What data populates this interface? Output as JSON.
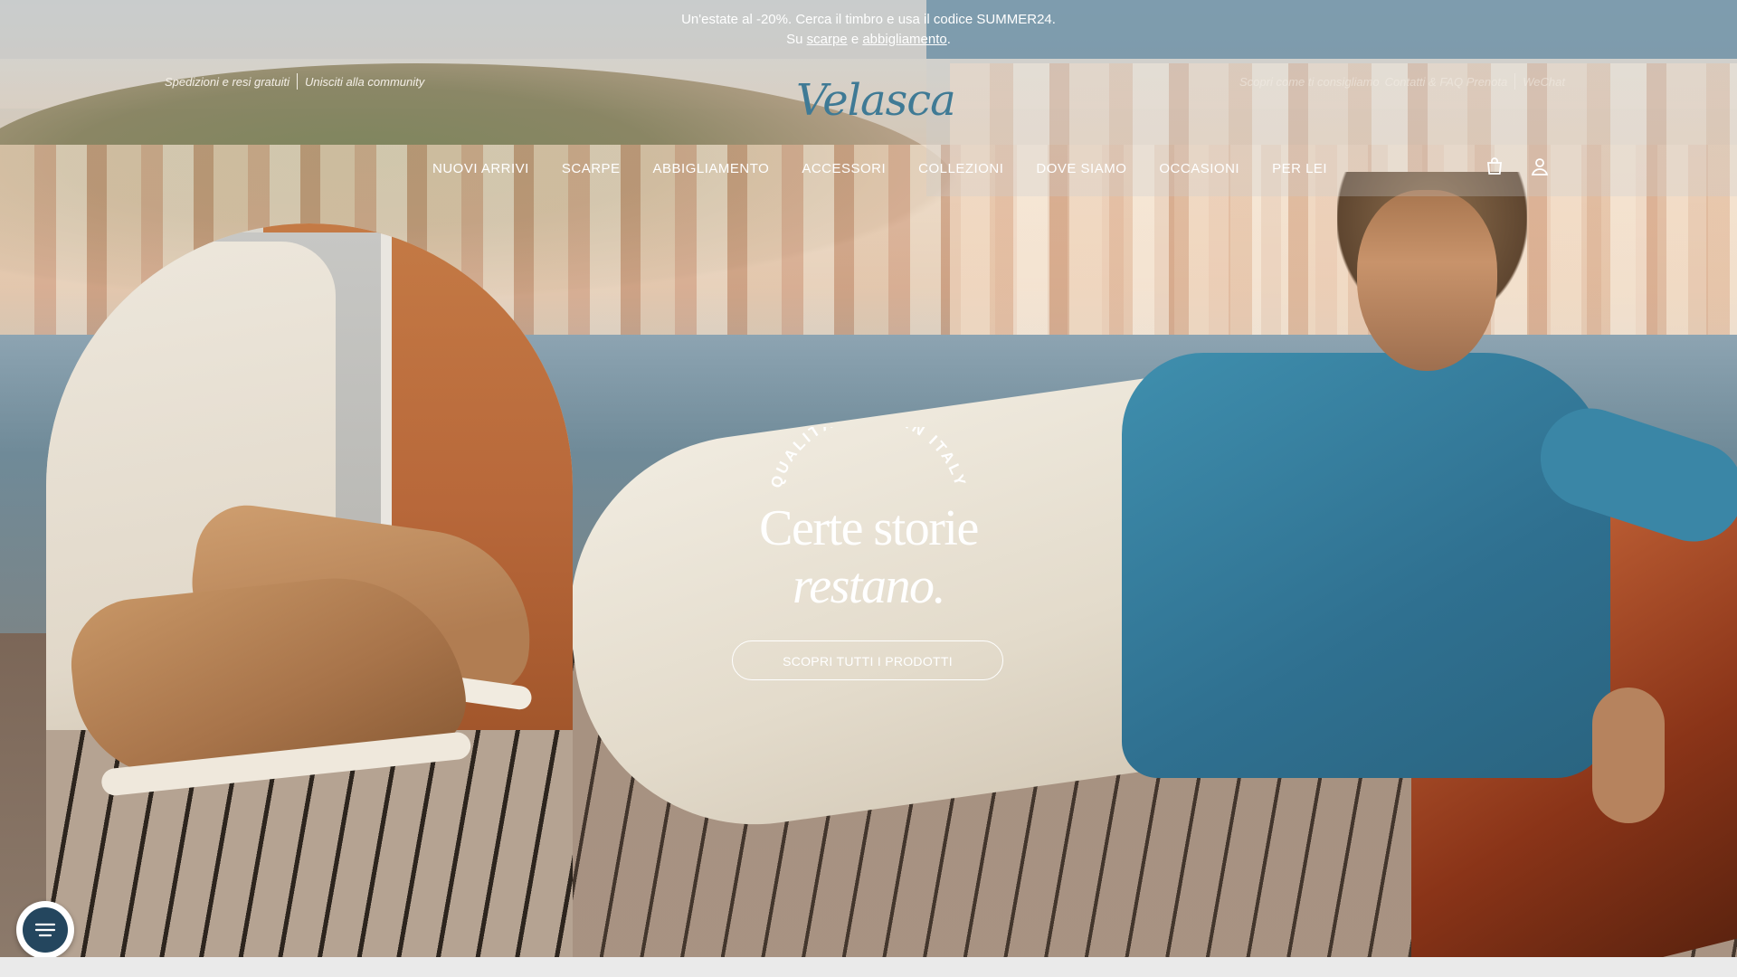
{
  "promo": {
    "line1": "Un'estate al -20%. Cerca il timbro e usa il codice SUMMER24.",
    "line2_prefix": "Su",
    "link_scarpe": "scarpe",
    "line2_mid": "e",
    "link_abbigliamento": "abbigliamento",
    "line2_suffix": "."
  },
  "utility_left": [
    "Spedizioni e resi gratuiti",
    "Unisciti alla community"
  ],
  "utility_right": [
    "Scopri come ti consigliamo",
    "Contatti & FAQ Prenota",
    "WeChat"
  ],
  "logo": {
    "text": "Velasca"
  },
  "nav": [
    "NUOVI ARRIVI",
    "SCARPE",
    "ABBIGLIAMENTO",
    "ACCESSORI",
    "COLLEZIONI",
    "DOVE SIAMO",
    "OCCASIONI",
    "PER LEI"
  ],
  "icons": {
    "cart": "shopping-bag-icon",
    "account": "user-icon",
    "chat": "chat-menu-icon"
  },
  "hero": {
    "badge": "QUALITÀ MADE IN ITALY",
    "headline_line1": "Certe storie",
    "headline_line2": "restano.",
    "cta": "SCOPRI TUTTI I PRODOTTI"
  },
  "colors": {
    "brand": "#3f7a95",
    "promo_accent": "#407496",
    "chat_bg": "#24465e"
  }
}
